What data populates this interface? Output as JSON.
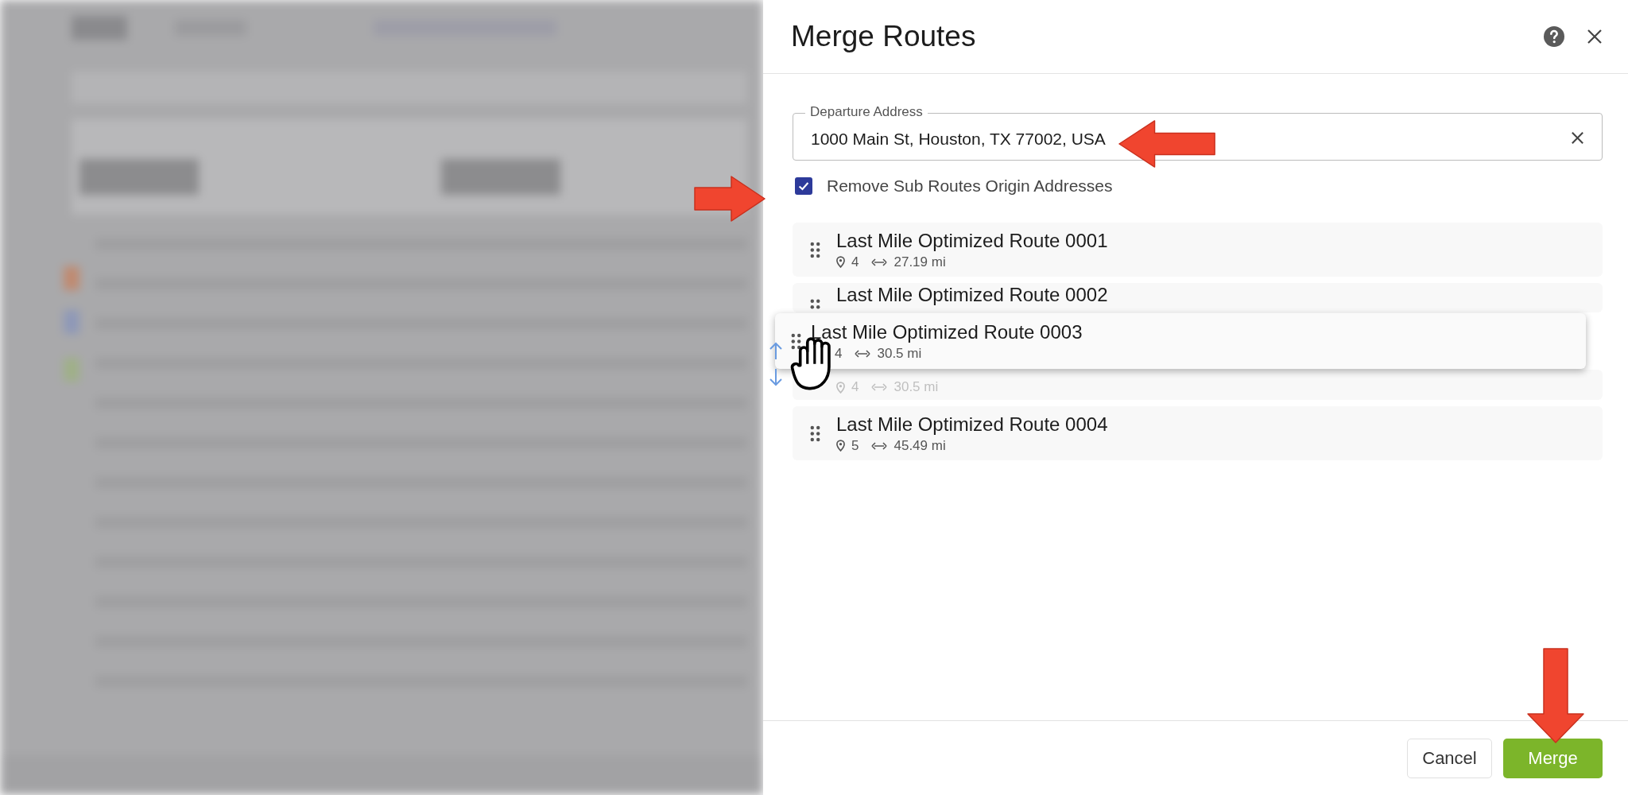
{
  "dialog": {
    "title": "Merge Routes"
  },
  "departure_field": {
    "label": "Departure Address",
    "value": "1000 Main St, Houston, TX 77002, USA"
  },
  "remove_origins": {
    "label": "Remove Sub Routes Origin Addresses",
    "checked": true
  },
  "routes": [
    {
      "kind": "item",
      "name": "Last Mile Optimized Route 0001",
      "stops": "4",
      "distance": "27.19 mi"
    },
    {
      "kind": "covered",
      "name": "Last Mile Optimized Route 0002"
    },
    {
      "kind": "ghost",
      "stops": "4",
      "distance": "30.5 mi"
    },
    {
      "kind": "item",
      "name": "Last Mile Optimized Route 0004",
      "stops": "5",
      "distance": "45.49 mi"
    }
  ],
  "dragged_route": {
    "name": "Last Mile Optimized Route 0003",
    "stops": "4",
    "distance": "30.5 mi"
  },
  "buttons": [
    {
      "kind": "secondary",
      "label": "Cancel"
    },
    {
      "kind": "primary",
      "label": "Merge"
    }
  ]
}
